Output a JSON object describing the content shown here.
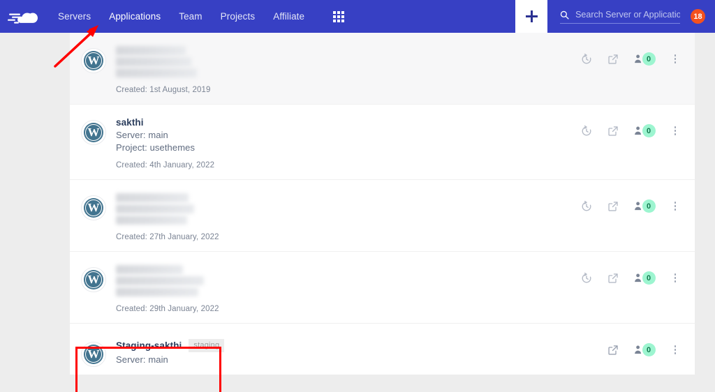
{
  "navbar": {
    "logo_icon": "cloudways-cloud-logo",
    "links": [
      {
        "label": "Servers",
        "active": false
      },
      {
        "label": "Applications",
        "active": true
      },
      {
        "label": "Team",
        "active": false
      },
      {
        "label": "Projects",
        "active": false
      },
      {
        "label": "Affiliate",
        "active": false
      }
    ],
    "grid_icon": "apps-grid-icon",
    "add_button": {
      "icon": "plus-icon",
      "label": "+"
    },
    "search": {
      "icon": "search-icon",
      "placeholder": "Search Server or Application",
      "value": ""
    },
    "notification_count": "18",
    "brand_color": "#3740c4",
    "badge_color": "#f4511e"
  },
  "applications": [
    {
      "name": "",
      "redacted": true,
      "redact_widths": [
        100,
        108,
        116
      ],
      "staging": null,
      "server": null,
      "project": null,
      "created": "Created: 1st August, 2019",
      "hovered": true,
      "actions": {
        "clone": true,
        "clone_icon": "clone-restore-icon",
        "launch_icon": "external-link-icon",
        "user_icon": "user-icon",
        "user_count": "0",
        "menu_icon": "kebab-menu-icon"
      }
    },
    {
      "name": "sakthi",
      "redacted": false,
      "staging": null,
      "server": "Server: main",
      "project": "Project: usethemes",
      "created": "Created: 4th January, 2022",
      "hovered": false,
      "actions": {
        "clone": true,
        "clone_icon": "clone-restore-icon",
        "launch_icon": "external-link-icon",
        "user_icon": "user-icon",
        "user_count": "0",
        "menu_icon": "kebab-menu-icon"
      }
    },
    {
      "name": "",
      "redacted": true,
      "redact_widths": [
        104,
        112,
        102
      ],
      "staging": null,
      "server": null,
      "project": null,
      "created": "Created: 27th January, 2022",
      "hovered": false,
      "actions": {
        "clone": true,
        "clone_icon": "clone-restore-icon",
        "launch_icon": "external-link-icon",
        "user_icon": "user-icon",
        "user_count": "0",
        "menu_icon": "kebab-menu-icon"
      }
    },
    {
      "name": "",
      "redacted": true,
      "redact_widths": [
        96,
        126,
        118
      ],
      "staging": null,
      "server": null,
      "project": null,
      "created": "Created: 29th January, 2022",
      "hovered": false,
      "actions": {
        "clone": true,
        "clone_icon": "clone-restore-icon",
        "launch_icon": "external-link-icon",
        "user_icon": "user-icon",
        "user_count": "0",
        "menu_icon": "kebab-menu-icon"
      }
    },
    {
      "name": "Staging-sakthi",
      "redacted": false,
      "staging": "staging",
      "server": "Server: main",
      "project": null,
      "created": null,
      "hovered": false,
      "actions": {
        "clone": false,
        "clone_icon": null,
        "launch_icon": "external-link-icon",
        "user_icon": "user-icon",
        "user_count": "0",
        "menu_icon": "kebab-menu-icon"
      }
    }
  ],
  "annotations": {
    "highlight_rect_color": "#ff0000",
    "arrow_color": "#ff0000",
    "arrow_target": "Applications"
  }
}
